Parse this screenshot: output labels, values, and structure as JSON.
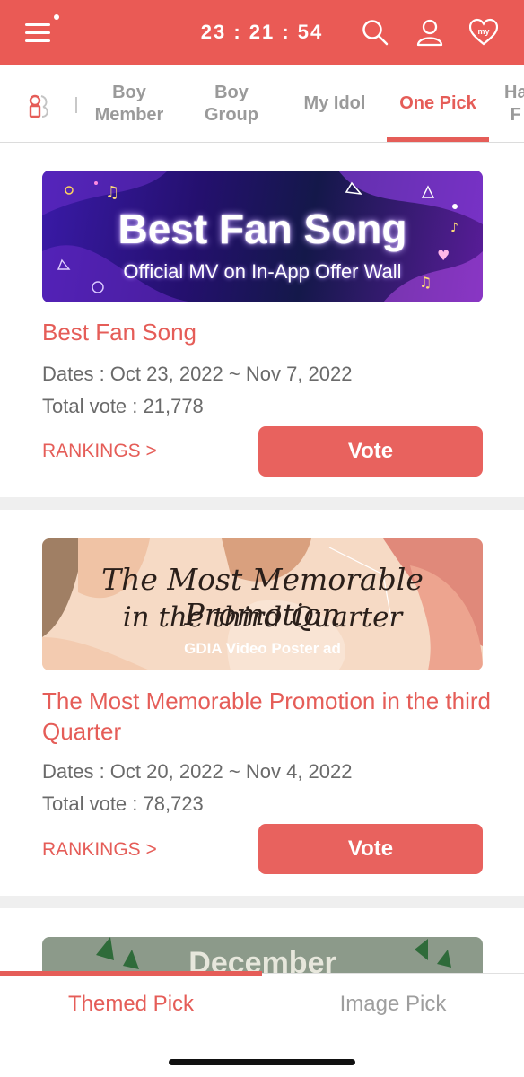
{
  "header": {
    "clock": "23 : 21 : 54",
    "icons": [
      "menu-icon",
      "search-icon",
      "user-icon",
      "heart-my-icon"
    ],
    "heart_badge": "my",
    "bar_color": "#ea5a55"
  },
  "tabs": {
    "items": [
      {
        "label": "Boy\nMember"
      },
      {
        "label": "Boy\nGroup"
      },
      {
        "label": "My Idol"
      },
      {
        "label": "One Pick"
      },
      {
        "label": "Ha\nF"
      }
    ],
    "active_index": 3,
    "accent": "#e55d58"
  },
  "cards": [
    {
      "banner_title": "Best Fan Song",
      "banner_subtitle": "Official MV on In-App Offer Wall",
      "title": "Best Fan Song",
      "dates": "Dates : Oct 23, 2022 ~ Nov 7, 2022",
      "total_vote": "Total vote : 21,778",
      "rankings": "RANKINGS >",
      "vote": "Vote"
    },
    {
      "banner_line1": "The Most Memorable Promotion",
      "banner_line2": "in the third Quarter",
      "banner_caption": "GDIA Video Poster ad",
      "title": "The Most Memorable Promotion in the third Quarter",
      "dates": "Dates : Oct 20, 2022 ~ Nov 4, 2022",
      "total_vote": "Total vote : 78,723",
      "rankings": "RANKINGS >",
      "vote": "Vote"
    },
    {
      "banner_line1": "December"
    }
  ],
  "bottom_tabs": {
    "items": [
      {
        "label": "Themed Pick"
      },
      {
        "label": "Image Pick"
      }
    ],
    "active_index": 0
  }
}
